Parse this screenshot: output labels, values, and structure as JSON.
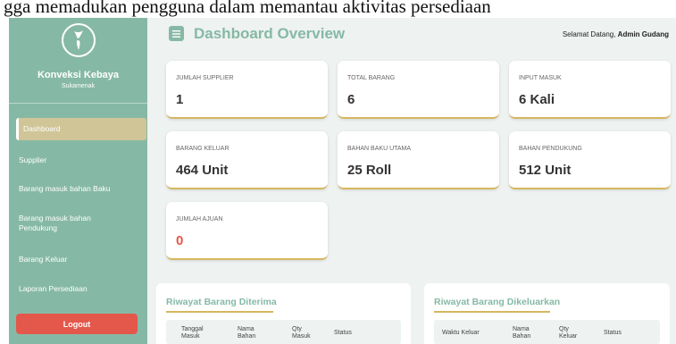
{
  "caption": "gga memadukan pengguna dalam memantau aktivitas persediaan",
  "colors": {
    "sidebar": "#86b9a5",
    "accent_gold": "#d6b65f",
    "danger": "#e4574b",
    "active_nav": "#cfc597"
  },
  "sidebar": {
    "logo_icon": "kebaya-logo-icon",
    "brand": "Konveksi Kebaya",
    "location": "Sukamenak",
    "items": [
      {
        "label": "Dashboard",
        "active": true
      },
      {
        "label": "Supplier"
      },
      {
        "label": "Barang masuk bahan Baku"
      },
      {
        "label": "Barang masuk bahan Pendukung"
      },
      {
        "label": "Barang Keluar"
      },
      {
        "label": "Laporan Persediaan"
      }
    ],
    "logout": "Logout"
  },
  "header": {
    "menu_icon": "hamburger-menu-icon",
    "title": "Dashboard Overview",
    "welcome_prefix": "Selamat Datang,",
    "welcome_user": "Admin Gudang"
  },
  "stats": [
    {
      "label": "JUMLAH SUPPLIER",
      "value": "1"
    },
    {
      "label": "TOTAL BARANG",
      "value": "6"
    },
    {
      "label": "INPUT MASUK",
      "value": "6 Kali"
    },
    {
      "label": "BARANG KELUAR",
      "value": "464 Unit"
    },
    {
      "label": "BAHAN BAKU UTAMA",
      "value": "25 Roll"
    },
    {
      "label": "BAHAN PENDUKUNG",
      "value": "512 Unit"
    },
    {
      "label": "JUMLAH AJUAN",
      "value": "0"
    }
  ],
  "received": {
    "title": "Riwayat Barang Diterima",
    "columns": [
      "Tanggal Masuk",
      "Nama Bahan",
      "Qty Masuk",
      "Status"
    ]
  },
  "issued": {
    "title": "Riwayat Barang Dikeluarkan",
    "columns": [
      "Waktu Keluar",
      "Nama Bahan",
      "Qty Keluar",
      "Status"
    ]
  }
}
